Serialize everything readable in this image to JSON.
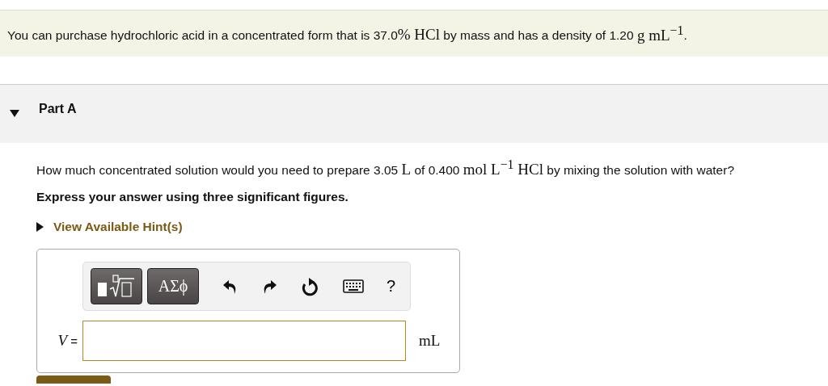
{
  "intro": [
    {
      "kind": "text",
      "text": "You can purchase hydrochloric acid in a concentrated form that is 37.0"
    },
    {
      "kind": "math",
      "text": "% HCl"
    },
    {
      "kind": "text",
      "text": " by mass and has a density of 1.20 "
    },
    {
      "kind": "math",
      "text": "g mL$^{−1}$"
    },
    {
      "kind": "text",
      "text": "."
    }
  ],
  "part": {
    "title": "Part A",
    "expanded": true
  },
  "question": [
    {
      "kind": "text",
      "text": "How much concentrated solution would you need to prepare 3.05 "
    },
    {
      "kind": "math",
      "text": "L"
    },
    {
      "kind": "text",
      "text": " of 0.400 "
    },
    {
      "kind": "math",
      "text": " mol L$^{−1}$ HCl"
    },
    {
      "kind": "text",
      "text": " by mixing the solution with water?"
    }
  ],
  "instruction": "Express your answer using three significant figures.",
  "hint": {
    "label": "View Available Hint(s)",
    "expanded": false
  },
  "toolbar": {
    "greek_button": "ΑΣϕ",
    "help": "?"
  },
  "answer": {
    "variable": "V",
    "equals": "=",
    "unit": "mL"
  }
}
